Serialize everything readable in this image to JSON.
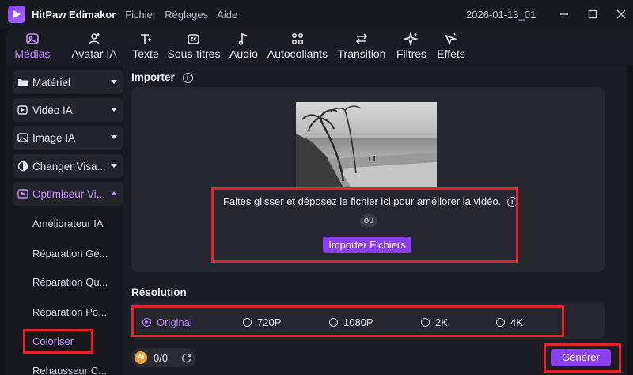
{
  "app": {
    "name": "HitPaw Edimakor",
    "project": "2026-01-13_01"
  },
  "menu": [
    "Fichier",
    "Réglages",
    "Aide"
  ],
  "toolbar": {
    "tabs": [
      {
        "label": "Médias",
        "icon": "media-icon",
        "active": true
      },
      {
        "label": "Avatar IA",
        "icon": "avatar-icon"
      },
      {
        "label": "Texte",
        "icon": "text-icon"
      },
      {
        "label": "Sous-titres",
        "icon": "subtitles-icon"
      },
      {
        "label": "Audio",
        "icon": "audio-icon"
      },
      {
        "label": "Autocollants",
        "icon": "stickers-icon"
      },
      {
        "label": "Transition",
        "icon": "transition-icon"
      },
      {
        "label": "Filtres",
        "icon": "filters-icon"
      },
      {
        "label": "Effets",
        "icon": "effects-icon"
      }
    ]
  },
  "sidebar": {
    "items": [
      {
        "label": "Matériel",
        "icon": "folder-icon"
      },
      {
        "label": "Vidéo IA",
        "icon": "video-ai-icon"
      },
      {
        "label": "Image IA",
        "icon": "image-ai-icon"
      },
      {
        "label": "Changer Visa...",
        "icon": "face-swap-icon"
      },
      {
        "label": "Optimiseur Vi...",
        "icon": "optimizer-icon",
        "open": true
      }
    ],
    "sub_items": [
      {
        "label": "Améliorateur IA"
      },
      {
        "label": "Réparation Gé..."
      },
      {
        "label": "Réparation Qu..."
      },
      {
        "label": "Réparation Po..."
      },
      {
        "label": "Coloriser",
        "active": true
      },
      {
        "label": "Rehausseur C..."
      }
    ]
  },
  "import": {
    "title": "Importer",
    "drop_text": "Faites glisser et déposez le fichier ici pour améliorer la vidéo.",
    "or": "ou",
    "button": "Importer Fichiers"
  },
  "resolution": {
    "title": "Résolution",
    "options": [
      "Original",
      "720P",
      "1080P",
      "2K",
      "4K"
    ],
    "selected": "Original"
  },
  "footer": {
    "credits": "0/0",
    "coin_label": "AI",
    "generate": "Générer"
  },
  "colors": {
    "accent": "#8a3ff0",
    "highlight": "#e3222c"
  }
}
